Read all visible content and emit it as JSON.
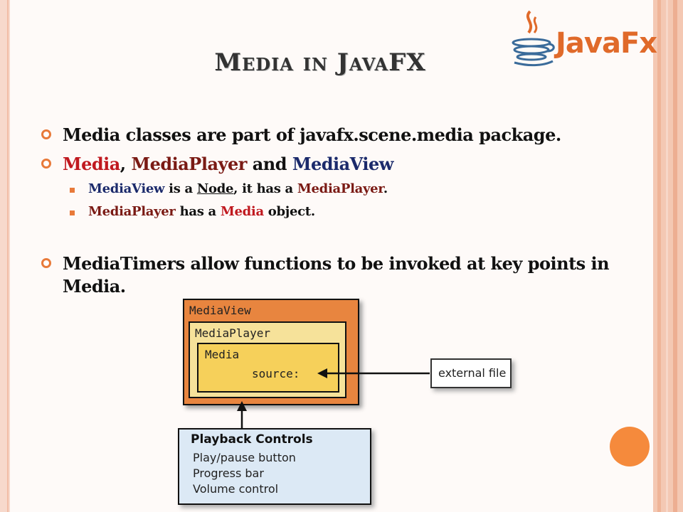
{
  "slide": {
    "title": "Media in JavaFX",
    "logo_text": "JavaFx",
    "bullets": [
      {
        "text": "Media classes are part of javafx.scene.media package."
      },
      {
        "media": "Media",
        "sep1": ", ",
        "mediaplayer": "MediaPlayer",
        "sep2": " and ",
        "mediaview": "MediaView"
      },
      {
        "text1": "MediaTimers allow functions to be invoked at key points in",
        "text2": "Media."
      }
    ],
    "sub_bullets": [
      {
        "mediaview": "MediaView",
        "a": " is a ",
        "node": "Node",
        "b": ", it has a ",
        "mediaplayer": "MediaPlayer",
        "c": "."
      },
      {
        "mediaplayer": "MediaPlayer",
        "a": " has a ",
        "media": "Media",
        "b": " object."
      }
    ]
  },
  "diagram": {
    "mediaview_label": "MediaView",
    "mediaplayer_label": "MediaPlayer",
    "media_label": "Media",
    "source_label": "source:",
    "external_label": "external file",
    "playback_title": "Playback Controls",
    "playback_items": [
      "Play/pause button",
      "Progress bar",
      "Volume control"
    ]
  },
  "colors": {
    "accent": "#e87a3a",
    "media_red": "#c0191f",
    "player_brown": "#7a1a14",
    "view_navy": "#1b2a6b"
  },
  "icons": {
    "logo": "java-cup-icon"
  }
}
